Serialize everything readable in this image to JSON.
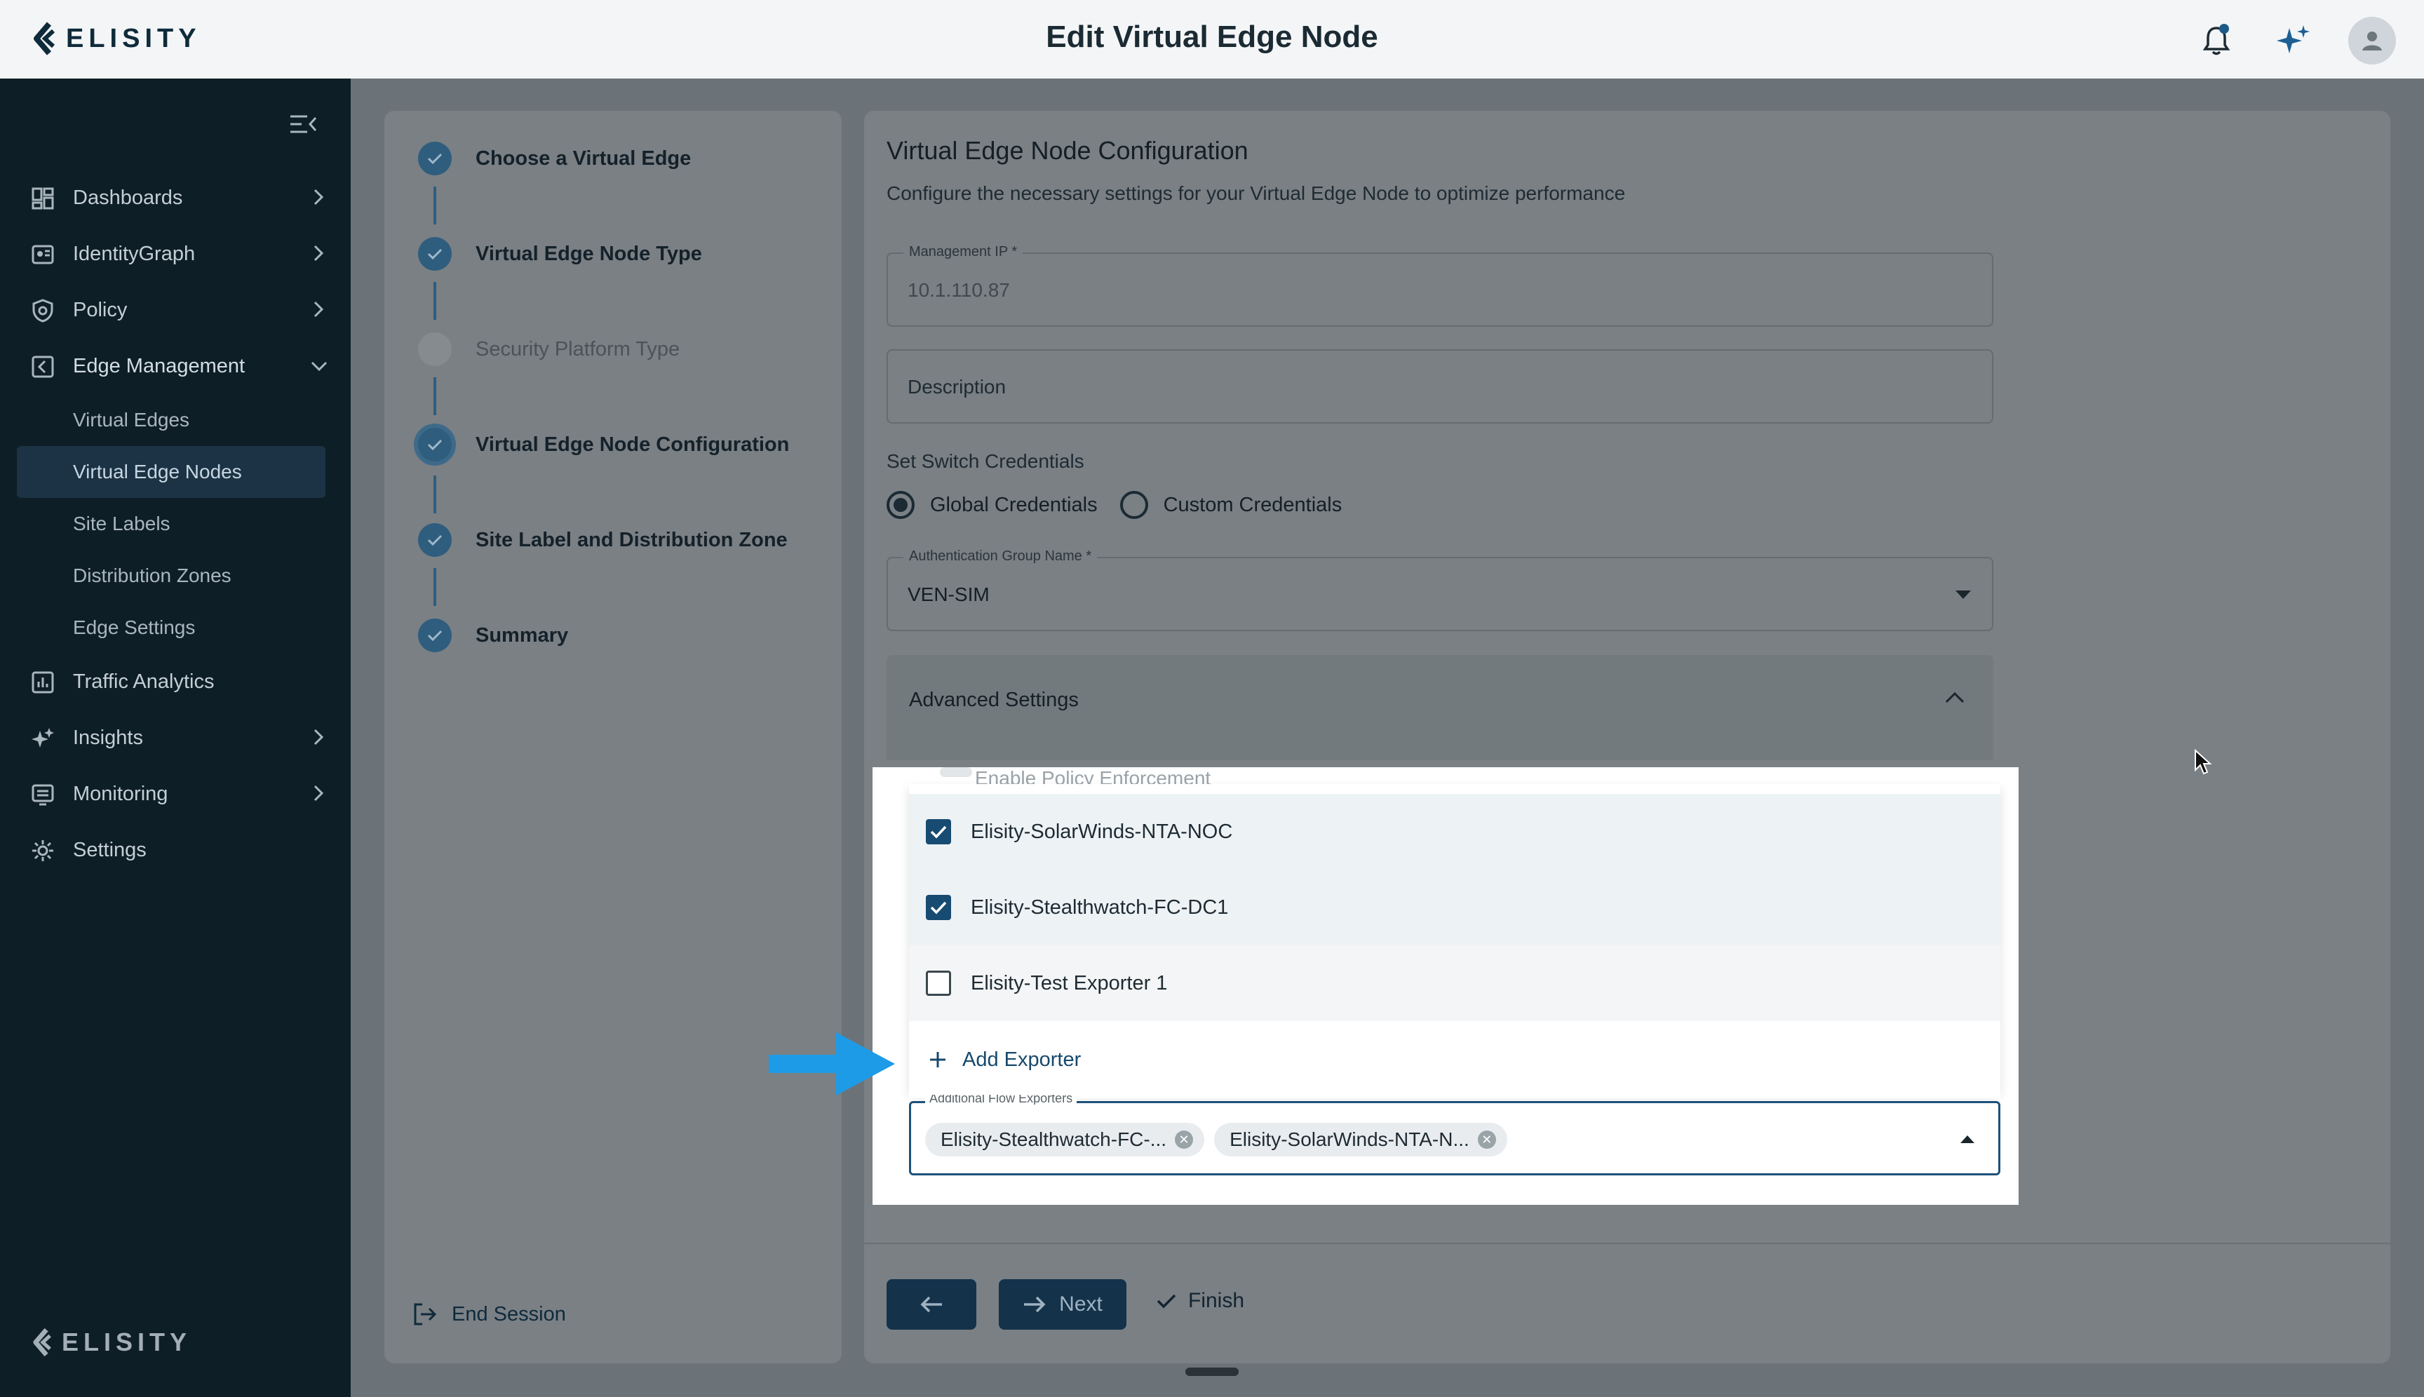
{
  "app": {
    "brand": "ELISITY",
    "page_title": "Edit Virtual Edge Node"
  },
  "colors": {
    "accent": "#184b71",
    "sidebar_bg": "#0e1e27",
    "arrow": "#1e9be6"
  },
  "header_icons": [
    "bell-icon",
    "sparkle-icon",
    "user-avatar-icon"
  ],
  "sidebar": {
    "items": [
      {
        "label": "Dashboards",
        "icon": "dashboard-icon"
      },
      {
        "label": "IdentityGraph",
        "icon": "identity-graph-icon"
      },
      {
        "label": "Policy",
        "icon": "shield-icon"
      },
      {
        "label": "Edge Management",
        "icon": "edge-management-icon"
      },
      {
        "label": "Traffic Analytics",
        "icon": "bar-chart-icon"
      },
      {
        "label": "Insights",
        "icon": "sparkle-icon"
      },
      {
        "label": "Monitoring",
        "icon": "monitor-icon"
      },
      {
        "label": "Settings",
        "icon": "gear-icon"
      }
    ],
    "sub_items": [
      {
        "label": "Virtual Edges",
        "active": false
      },
      {
        "label": "Virtual Edge Nodes",
        "active": true
      },
      {
        "label": "Site Labels",
        "active": false
      },
      {
        "label": "Distribution Zones",
        "active": false
      },
      {
        "label": "Edge Settings",
        "active": false
      }
    ],
    "footer_brand": "ELISITY"
  },
  "stepper": {
    "steps": [
      {
        "label": "Choose a Virtual Edge",
        "state": "done"
      },
      {
        "label": "Virtual Edge Node Type",
        "state": "done"
      },
      {
        "label": "Security Platform Type",
        "state": "skipped"
      },
      {
        "label": "Virtual Edge Node Configuration",
        "state": "active"
      },
      {
        "label": "Site Label and Distribution Zone",
        "state": "done"
      },
      {
        "label": "Summary",
        "state": "done"
      }
    ],
    "end_session": "End Session"
  },
  "config": {
    "title": "Virtual Edge Node Configuration",
    "subtitle": "Configure the necessary settings for your Virtual Edge Node to optimize performance",
    "management_ip": {
      "label": "Management IP *",
      "value": "10.1.110.87"
    },
    "description": {
      "placeholder": "Description"
    },
    "switch_credentials": {
      "label": "Set Switch Credentials",
      "options": [
        "Global Credentials",
        "Custom Credentials"
      ],
      "selected": "Global Credentials"
    },
    "auth_group": {
      "label": "Authentication Group Name *",
      "value": "VEN-SIM"
    },
    "advanced": {
      "title": "Advanced Settings",
      "policy_enforcement": "Enable Policy Enforcement"
    }
  },
  "dropdown": {
    "options": [
      {
        "label": "Elisity-SolarWinds-NTA-NOC",
        "checked": true
      },
      {
        "label": "Elisity-Stealthwatch-FC-DC1",
        "checked": true
      },
      {
        "label": "Elisity-Test Exporter 1",
        "checked": false
      }
    ],
    "add_label": "Add Exporter",
    "field_label": "Additional Flow Exporters",
    "chips": [
      "Elisity-Stealthwatch-FC-...",
      "Elisity-SolarWinds-NTA-N..."
    ]
  },
  "actions": {
    "next": "Next",
    "finish": "Finish"
  }
}
